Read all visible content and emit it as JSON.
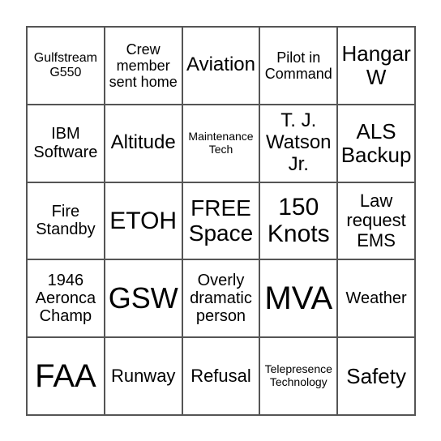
{
  "board": {
    "cells": [
      "Gulfstream\nG550",
      "Crew\nmember\nsent home",
      "Aviation",
      "Pilot in\nCommand",
      "Hangar\nW",
      "IBM\nSoftware",
      "Altitude",
      "Maintenance\nTech",
      "T. J.\nWatson\nJr.",
      "ALS\nBackup",
      "Fire\nStandby",
      "ETOH",
      "FREE\nSpace",
      "150\nKnots",
      "Law\nrequest\nEMS",
      "1946\nAeronca\nChamp",
      "GSW",
      "Overly\ndramatic\nperson",
      "MVA",
      "Weather",
      "FAA",
      "Runway",
      "Refusal",
      "Telepresence\nTechnology",
      "Safety"
    ]
  }
}
